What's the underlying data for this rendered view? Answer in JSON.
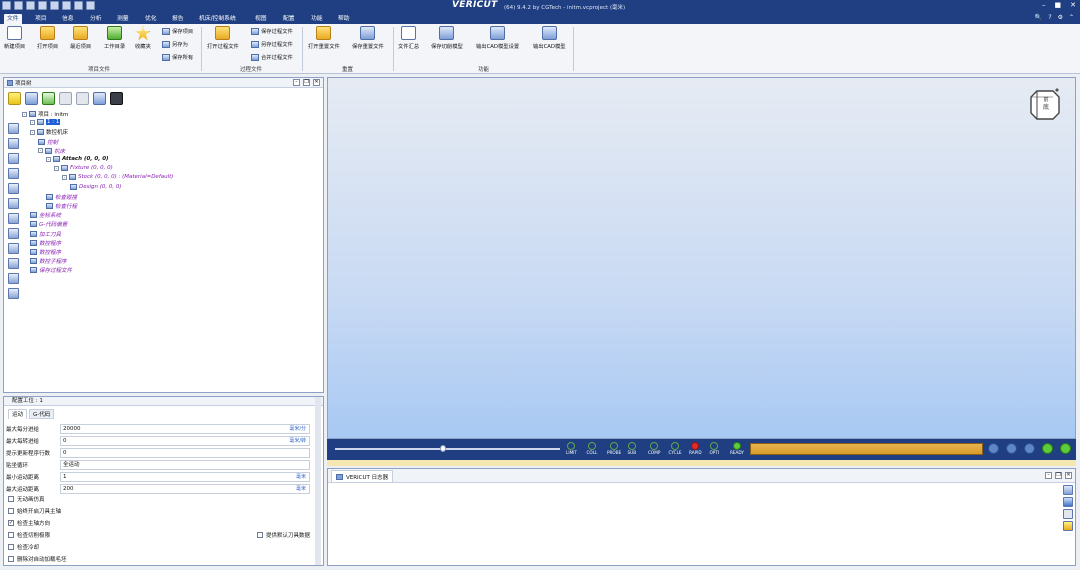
{
  "app": {
    "brand": "VERICUT",
    "version_text": "(64) 9.4.2 by CGTech - initm.vcproject (毫米)",
    "window_controls": [
      "–",
      "■",
      "✕"
    ]
  },
  "menu": {
    "tabs": [
      "文件",
      "项目",
      "信息",
      "分析",
      "测量",
      "优化",
      "报告",
      "机床/控制系统",
      "视图",
      "配置",
      "功能",
      "帮助"
    ],
    "active": "文件",
    "right_icons": [
      "🔍",
      "?",
      "⚙",
      "⌃"
    ]
  },
  "ribbon": {
    "project_group": {
      "label": "项目文件",
      "new": "新建项目",
      "open": "打开项目",
      "recent": "最近项目",
      "workdir": "工作目录",
      "favorites": "收藏夹",
      "save": "保存项目",
      "save_as": "另存为",
      "save_all": "保存所有"
    },
    "process_group": {
      "label": "过程文件",
      "open": "打开过程文件",
      "save": "保存过程文件",
      "save_as": "另存过程文件",
      "merge": "合并过程文件"
    },
    "reset_group": {
      "label": "重置",
      "open": "打开重置文件",
      "save": "保存重置文件"
    },
    "func_group": {
      "label": "功能",
      "summary": "文件汇总",
      "save_cut": "保存切削模型",
      "export_settings": "输出CAD模型设置",
      "export": "输出CAD模型"
    }
  },
  "project_tree": {
    "title": "项目树",
    "nodes": [
      {
        "text": "项目 : initm",
        "style": "",
        "indent": 0,
        "expander": "⊟"
      },
      {
        "text": "1 : 1",
        "style": "sel",
        "indent": 1,
        "expander": "⊟"
      },
      {
        "text": "数控机床",
        "style": "",
        "indent": 1,
        "expander": "⊟"
      },
      {
        "text": "控制",
        "style": "purple",
        "indent": 2,
        "expander": ""
      },
      {
        "text": "机床",
        "style": "purple",
        "indent": 2,
        "expander": "⊟"
      },
      {
        "text": "Attach (0, 0, 0)",
        "style": "bold",
        "indent": 3,
        "expander": "⊟"
      },
      {
        "text": "Fixture (0, 0, 0)",
        "style": "purple",
        "indent": 4,
        "expander": "⊟"
      },
      {
        "text": "Stock (0, 0, 0) : (Material=Default)",
        "style": "purple",
        "indent": 5,
        "expander": "⊟"
      },
      {
        "text": "Design (0, 0, 0)",
        "style": "purple",
        "indent": 6,
        "expander": ""
      },
      {
        "text": "检查碰撞",
        "style": "purple",
        "indent": 3,
        "expander": ""
      },
      {
        "text": "检查行程",
        "style": "purple",
        "indent": 3,
        "expander": ""
      },
      {
        "text": "坐标系统",
        "style": "purple",
        "indent": 1,
        "expander": ""
      },
      {
        "text": "G-代码偏置",
        "style": "purple",
        "indent": 1,
        "expander": ""
      },
      {
        "text": "加工刀具",
        "style": "purple",
        "indent": 1,
        "expander": ""
      },
      {
        "text": "数控程序",
        "style": "purple",
        "indent": 1,
        "expander": ""
      },
      {
        "text": "数控程序",
        "style": "purple",
        "indent": 1,
        "expander": ""
      },
      {
        "text": "数控子程序",
        "style": "purple",
        "indent": 1,
        "expander": ""
      },
      {
        "text": "保存过程文件",
        "style": "purple",
        "indent": 1,
        "expander": ""
      }
    ]
  },
  "config": {
    "title": "配置工位 : 1",
    "tabs": [
      "运动",
      "G-代码"
    ],
    "active_tab": "运动",
    "fields": [
      {
        "label": "最大每分进给",
        "value": "20000",
        "unit": "毫米/分"
      },
      {
        "label": "最大每转进给",
        "value": "0",
        "unit": "毫米/转"
      },
      {
        "label": "提示更新程序行数",
        "value": "0",
        "unit": ""
      },
      {
        "label": "贴坐循环",
        "value": "全运动",
        "unit": ""
      },
      {
        "label": "最小运动距离",
        "value": "1",
        "unit": "毫米"
      },
      {
        "label": "最大运动距离",
        "value": "200",
        "unit": "毫米"
      }
    ],
    "checks": [
      {
        "label": "无动画仿真",
        "checked": false
      },
      {
        "label": "始终开启刀具主轴",
        "checked": false
      },
      {
        "label": "检查主轴方向",
        "checked": true
      },
      {
        "label": "检查切削极限",
        "checked": false
      },
      {
        "label": "检查冷却",
        "checked": false
      },
      {
        "label": "删除对自动加载毛坯",
        "checked": false
      }
    ],
    "extra_check": "提供默认刀具数据"
  },
  "viewport": {
    "cube_labels": [
      "前",
      "底"
    ]
  },
  "status": {
    "leds": [
      "LIMIT",
      "COLL",
      "PROBE",
      "SUB",
      "COMP",
      "CYCLE",
      "RAPID",
      "OPTI",
      "READY"
    ],
    "slider_percent": 50
  },
  "log": {
    "tab_label": "VERICUT 日志器"
  }
}
